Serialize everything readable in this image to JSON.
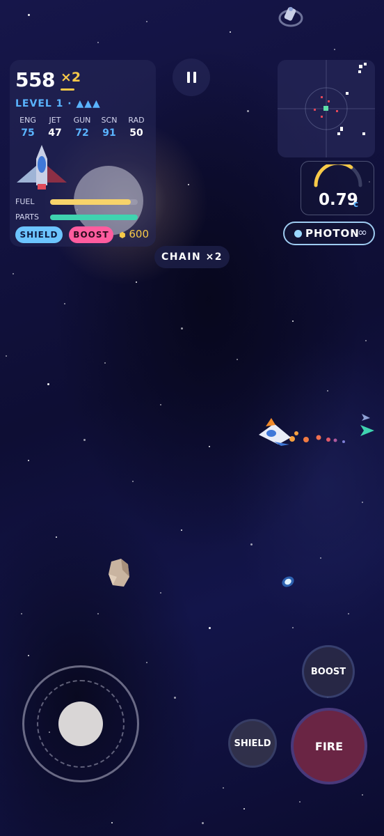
{
  "hud": {
    "score": "558",
    "multiplier": "×2",
    "level": "LEVEL 1 · ▲▲▲",
    "stats": [
      {
        "label": "ENG",
        "value": "75",
        "color": "#5ab4ff"
      },
      {
        "label": "JET",
        "value": "47",
        "color": "#ffffff"
      },
      {
        "label": "GUN",
        "value": "72",
        "color": "#5ab4ff"
      },
      {
        "label": "SCN",
        "value": "91",
        "color": "#5ab4ff"
      },
      {
        "label": "RAD",
        "value": "50",
        "color": "#ffffff"
      }
    ],
    "fuel_label": "FUEL",
    "fuel_level": 0.92,
    "parts_label": "PARTS",
    "parts_level": 1.0,
    "shield_label": "SHIELD",
    "boost_label": "BOOST",
    "coins": "600",
    "coin_icon": "⬢"
  },
  "chain_label": "CHAIN ×2",
  "speed": {
    "value": "0.79",
    "unit": "c",
    "gauge_fraction": 0.7
  },
  "weapon": {
    "name": "PHOTON",
    "ammo": "∞"
  },
  "controls": {
    "boost": "BOOST",
    "shield": "SHIELD",
    "fire": "FIRE"
  },
  "colors": {
    "accent_blue": "#5ab4ff",
    "gold": "#f7c948",
    "fuel_bar": "#f7d36a",
    "parts_bar": "#3fd3b0",
    "shield_pill": "#6cc4ff",
    "boost_pill": "#ff5c9e",
    "fire_button": "#6a2544"
  },
  "icons": {
    "pause": "pause-icon",
    "ship": "player-ship-icon",
    "enemy": "enemy-arrow-icon",
    "asteroid": "asteroid-icon",
    "satellite": "satellite-icon"
  }
}
